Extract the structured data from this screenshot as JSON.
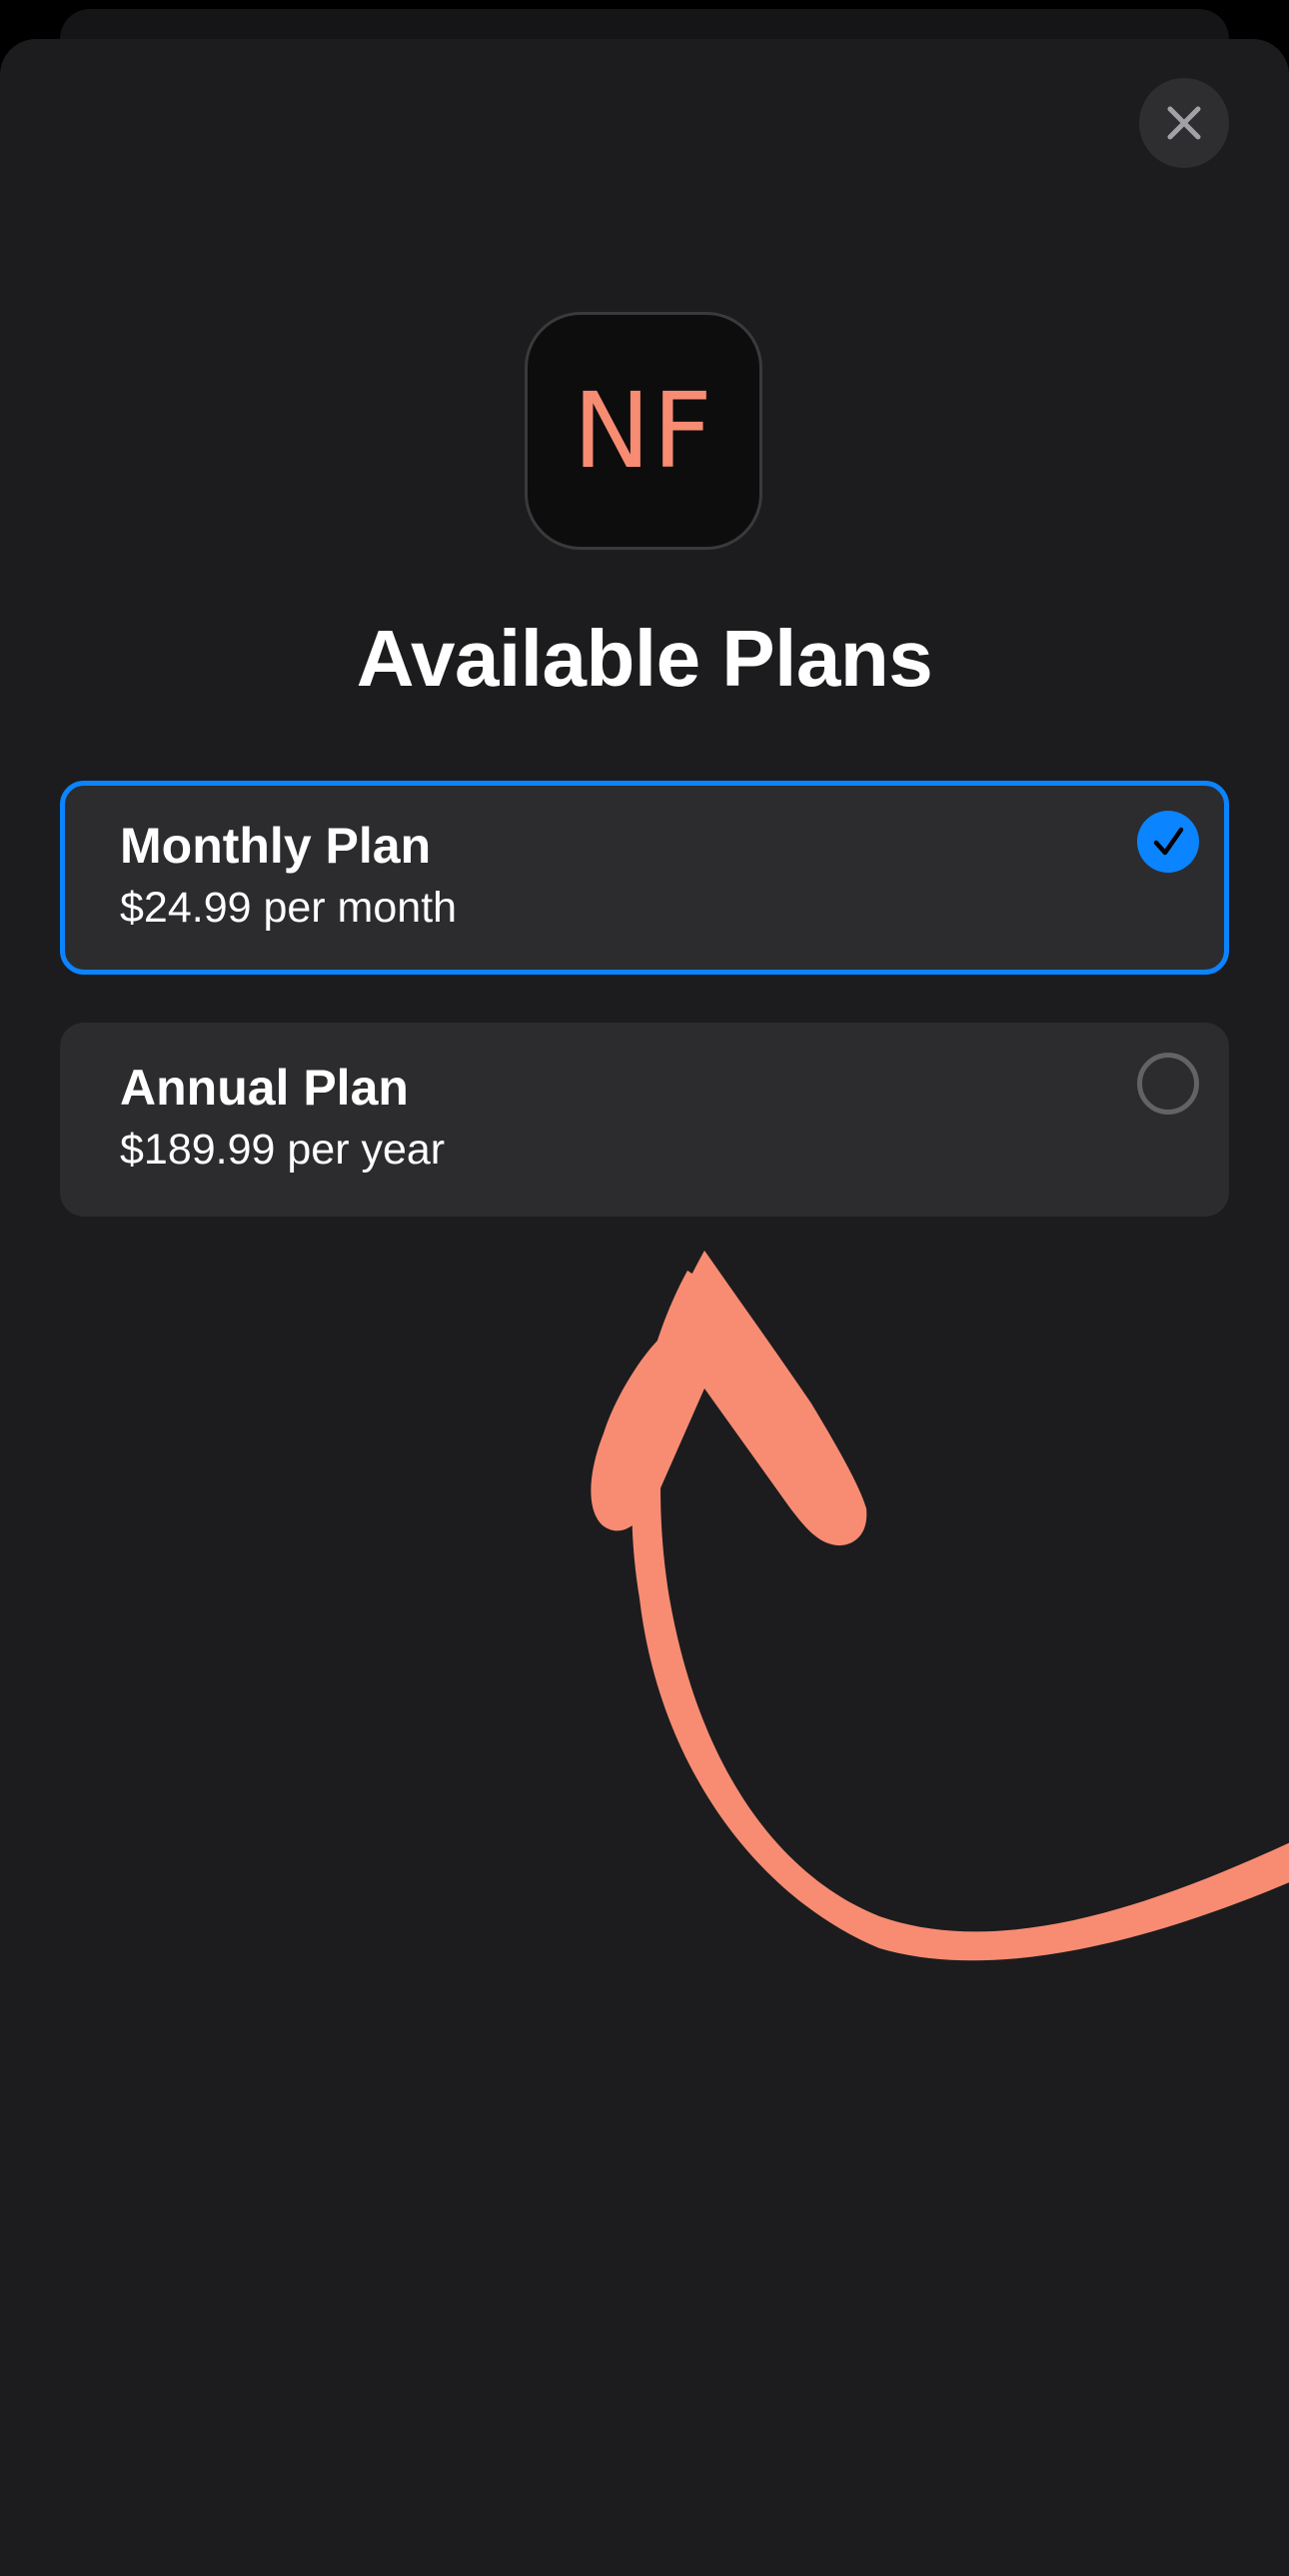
{
  "sheet": {
    "close_icon": "close-icon",
    "app_icon_text": "NF",
    "title": "Available Plans"
  },
  "plans": [
    {
      "name": "Monthly Plan",
      "price": "$24.99 per month",
      "selected": true
    },
    {
      "name": "Annual Plan",
      "price": "$189.99 per year",
      "selected": false
    }
  ],
  "colors": {
    "background": "#1c1c1e",
    "card": "#2c2c2e",
    "accent": "#0a84ff",
    "annotation_arrow": "#f78c73"
  }
}
